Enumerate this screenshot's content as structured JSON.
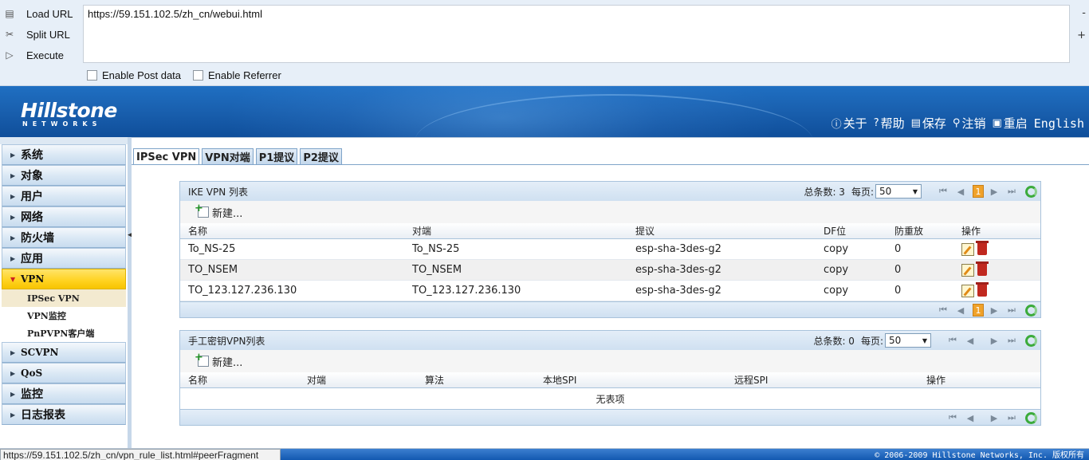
{
  "hackbar": {
    "load_label": "Load URL",
    "split_label": "Split URL",
    "execute_label": "Execute",
    "url_value": "https://59.151.102.5/zh_cn/webui.html",
    "minus": "-",
    "plus": "+",
    "post_label": "Enable Post data",
    "referrer_label": "Enable Referrer"
  },
  "header": {
    "logo": "Hillstone",
    "logo_sub": "NETWORKS",
    "links": {
      "about": "关于",
      "help": "帮助",
      "save": "保存",
      "logout": "注销",
      "restart": "重启",
      "english": "English"
    }
  },
  "sidebar": {
    "items": [
      {
        "label": "系统"
      },
      {
        "label": "对象"
      },
      {
        "label": "用户"
      },
      {
        "label": "网络"
      },
      {
        "label": "防火墙"
      },
      {
        "label": "应用"
      },
      {
        "label": "VPN"
      },
      {
        "label": "SCVPN"
      },
      {
        "label": "QoS"
      },
      {
        "label": "监控"
      },
      {
        "label": "日志报表"
      }
    ],
    "vpn_sub": [
      {
        "label": "IPSec VPN"
      },
      {
        "label": "VPN监控"
      },
      {
        "label": "PnPVPN客户端"
      }
    ]
  },
  "tabs": [
    "IPSec VPN",
    "VPN对端",
    "P1提议",
    "P2提议"
  ],
  "ike_panel": {
    "title": "IKE VPN 列表",
    "total_label": "总条数: 3",
    "per_page_label": "每页:",
    "per_page_value": "50",
    "page": "1",
    "new_label": "新建...",
    "columns": [
      "名称",
      "对端",
      "提议",
      "DF位",
      "防重放",
      "操作"
    ],
    "rows": [
      [
        "To_NS-25",
        "To_NS-25",
        "esp-sha-3des-g2",
        "copy",
        "0"
      ],
      [
        "TO_NSEM",
        "TO_NSEM",
        "esp-sha-3des-g2",
        "copy",
        "0"
      ],
      [
        "TO_123.127.236.130",
        "TO_123.127.236.130",
        "esp-sha-3des-g2",
        "copy",
        "0"
      ]
    ]
  },
  "manual_panel": {
    "title": "手工密钥VPN列表",
    "total_label": "总条数: 0",
    "per_page_label": "每页:",
    "per_page_value": "50",
    "new_label": "新建...",
    "columns": [
      "名称",
      "对端",
      "算法",
      "本地SPI",
      "远程SPI",
      "操作"
    ],
    "empty_text": "无表项"
  },
  "statusbar": {
    "url": "https://59.151.102.5/zh_cn/vpn_rule_list.html#peerFragment",
    "copyright": "© 2006-2009 Hillstone Networks, Inc. 版权所有"
  }
}
